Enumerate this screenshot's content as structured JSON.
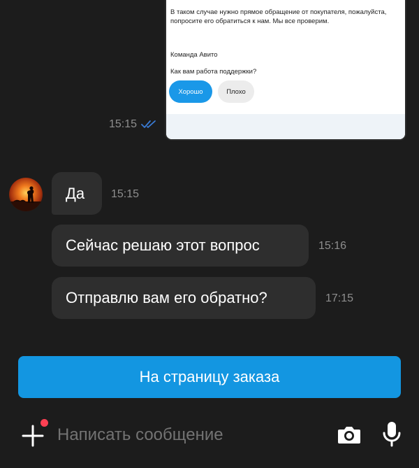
{
  "screenshot_message": {
    "paragraph": "В таком случае нужно прямое обращение от покупателя, пожалуйста, попросите его обратиться к нам. Мы все проверим.",
    "signature": "Команда Авито",
    "question": "Как вам работа поддержки?",
    "good_label": "Хорошо",
    "bad_label": "Плохо",
    "time": "15:15",
    "status_icon": "double-check-icon",
    "accent_color": "#1a98e8"
  },
  "messages": [
    {
      "text": "Да",
      "time": "15:15"
    },
    {
      "text": "Сейчас решаю этот вопрос",
      "time": "15:16"
    },
    {
      "text": "Отправлю вам его обратно?",
      "time": "17:15"
    }
  ],
  "order_button": {
    "label": "На страницу заказа",
    "color": "#1396e1"
  },
  "composer": {
    "placeholder": "Написать сообщение",
    "attach_icon": "plus-icon",
    "camera_icon": "camera-icon",
    "mic_icon": "microphone-icon",
    "notification_dot_color": "#ff4053"
  }
}
